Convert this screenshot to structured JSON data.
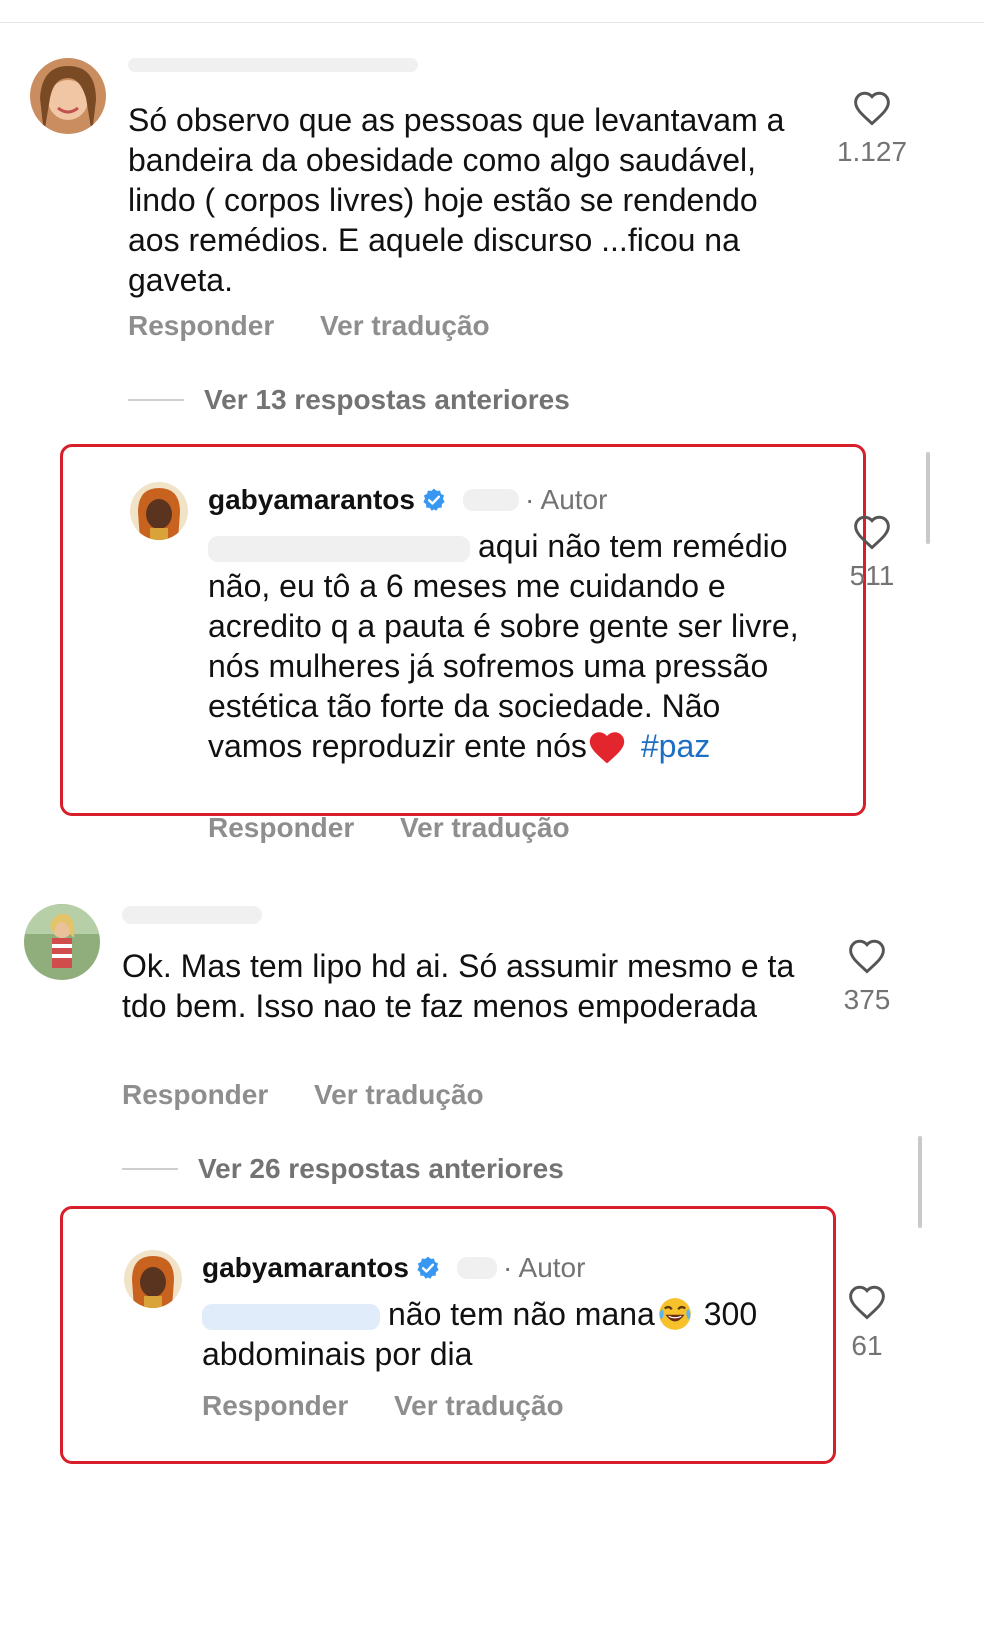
{
  "colors": {
    "highlight": "#d81e2b",
    "mention": "#3d7ec7",
    "verified": "#3897f0",
    "heart": "#e3262e"
  },
  "comments": [
    {
      "username": "",
      "text": "Só observo que  as pessoas que levantavam a bandeira da obesidade como algo saudável, lindo ( corpos livres) hoje estão se rendendo aos remédios. E aquele discurso ...ficou na gaveta.",
      "likes": "1.127",
      "reply_label": "Responder",
      "translate_label": "Ver tradução"
    },
    {
      "username": "",
      "text": "Ok. Mas tem lipo hd ai. Só assumir mesmo e ta tdo bem. Isso nao te faz menos empoderada",
      "likes": "375",
      "reply_label": "Responder",
      "translate_label": "Ver tradução"
    }
  ],
  "more_replies": [
    {
      "label": "Ver 13 respostas anteriores"
    },
    {
      "label": "Ver 26 respostas anteriores"
    }
  ],
  "replies": [
    {
      "username": "gabyamarantos",
      "author_label": "· Autor",
      "text_before": "aqui não tem remédio não, eu tô a 6 meses me cuidando e acredito q a pauta é sobre gente ser livre, nós mulheres já sofremos uma pressão estética tão forte da sociedade. Não vamos reproduzir ente nós",
      "emoji": "heart",
      "hashtag": "#paz",
      "likes": "511",
      "reply_label": "Responder",
      "translate_label": "Ver tradução"
    },
    {
      "username": "gabyamarantos",
      "author_label": "· Autor",
      "text_line1": "não tem não mana",
      "text_after_emoji": "300",
      "text_line2": "abdominais por dia",
      "emoji": "laughing-crying",
      "likes": "61",
      "reply_label": "Responder",
      "translate_label": "Ver tradução"
    }
  ]
}
